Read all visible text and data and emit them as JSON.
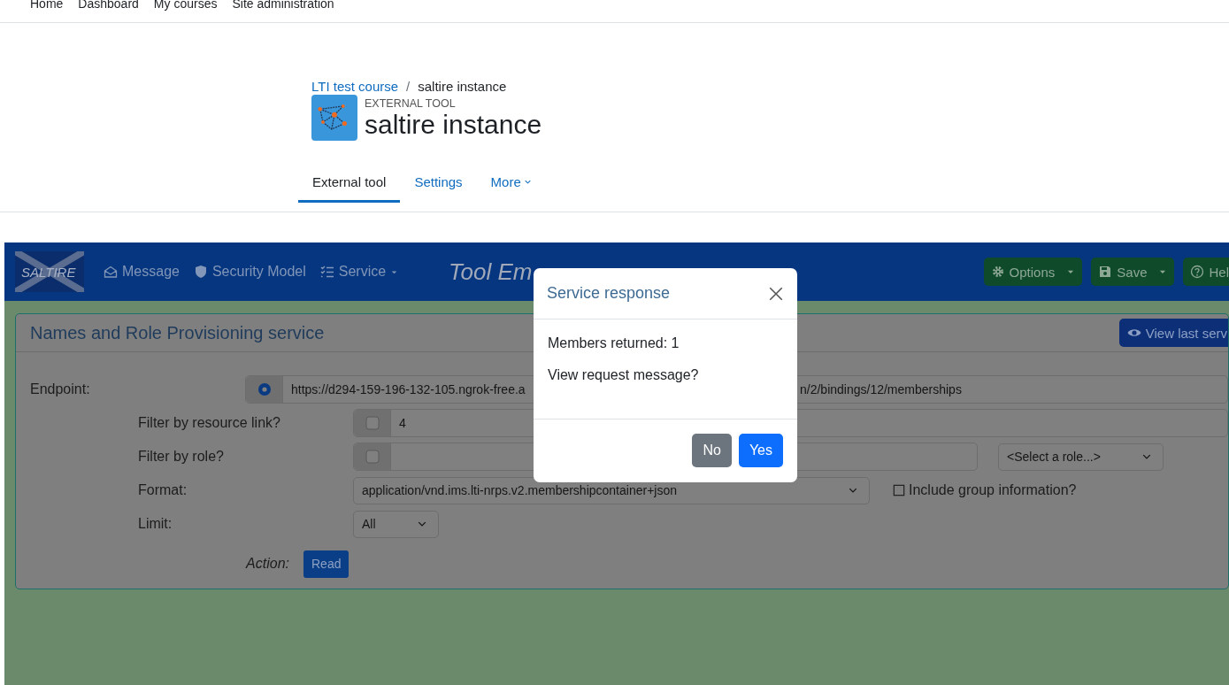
{
  "top_nav": {
    "items": [
      "Home",
      "Dashboard",
      "My courses",
      "Site administration"
    ]
  },
  "breadcrumb": {
    "items": [
      {
        "label": "LTI test course",
        "link": true
      },
      {
        "label": "saltire instance",
        "link": false
      }
    ],
    "separator": "/"
  },
  "header": {
    "pretitle": "EXTERNAL TOOL",
    "title": "saltire instance"
  },
  "tabs": [
    {
      "label": "External tool",
      "selected": true,
      "dropdown": false
    },
    {
      "label": "Settings",
      "selected": false,
      "dropdown": false
    },
    {
      "label": "More",
      "selected": false,
      "dropdown": true
    }
  ],
  "tool": {
    "logo": "SALTIRE",
    "nav": [
      {
        "label": "Message",
        "dropdown": false
      },
      {
        "label": "Security Model",
        "dropdown": false
      },
      {
        "label": "Service",
        "dropdown": true
      }
    ],
    "title": "Tool Em",
    "buttons": [
      {
        "label": "Options",
        "split": true
      },
      {
        "label": "Save",
        "split": true
      },
      {
        "label": "Hel",
        "split": false
      }
    ]
  },
  "panel": {
    "title": "Names and Role Provisioning service",
    "view_button": "View last serv",
    "endpoint": {
      "label": "Endpoint:",
      "selected": true,
      "value_start": "https://d294-159-196-132-105.ngrok-free.a",
      "value_end": "n/2/bindings/12/memberships"
    },
    "filters": [
      {
        "label": "Filter by resource link?",
        "checked": false,
        "value": "4"
      },
      {
        "label": "Filter by role?",
        "checked": false,
        "role_select": "<Select a role...>"
      }
    ],
    "format": {
      "label": "Format:",
      "value": "application/vnd.ims.lti-nrps.v2.membershipcontainer+json"
    },
    "include_group": {
      "label": "Include group information?",
      "checked": false
    },
    "limit": {
      "label": "Limit:",
      "value": "All"
    },
    "action": {
      "label": "Action:",
      "button": "Read"
    }
  },
  "modal": {
    "title": "Service response",
    "lines": [
      "Members returned: 1",
      "View request message?"
    ],
    "buttons": [
      {
        "label": "No",
        "kind": "secondary"
      },
      {
        "label": "Yes",
        "kind": "primary"
      }
    ]
  }
}
